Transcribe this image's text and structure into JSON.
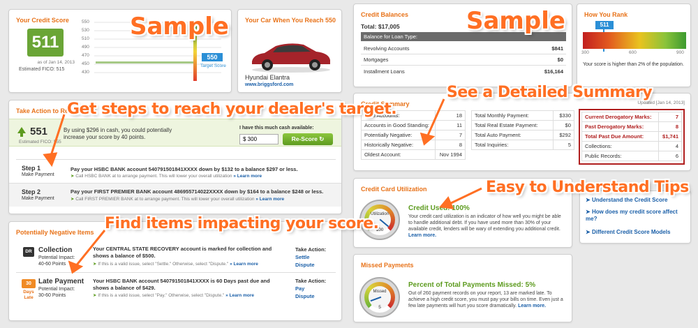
{
  "annotations": {
    "sample_left": "Sample",
    "sample_right": "Sample",
    "dealer": "Get steps to reach your dealer's target.",
    "items": "Find items impacting your score.",
    "summary": "See a Detailed Summary",
    "tips": "Easy to Understand Tips"
  },
  "credit_score": {
    "title": "Your Credit Score",
    "score": "511",
    "as_of": "as of Jan 14, 2013",
    "fico": "Estimated FICO: 515",
    "target_value": "550",
    "target_label": "Target Score",
    "ticks": [
      "550",
      "530",
      "510",
      "490",
      "470",
      "450",
      "430"
    ]
  },
  "car": {
    "title": "Your Car When You Reach 550",
    "model": "Hyundai Elantra",
    "url": "www.briggsford.com"
  },
  "balances": {
    "title": "Credit Balances",
    "total": "Total: $17,005",
    "header": "Balance for Loan Type:",
    "rows": [
      {
        "label": "Revolving Accounts",
        "value": "$841"
      },
      {
        "label": "Mortgages",
        "value": "$0"
      },
      {
        "label": "Installment Loans",
        "value": "$16,164"
      }
    ]
  },
  "rank": {
    "title": "How You Rank",
    "score": "511",
    "min": "300",
    "mid": "600",
    "max": "900",
    "text": "Your score is higher than 2% of the population."
  },
  "take_action": {
    "title": "Take Action to Re",
    "new_score": "551",
    "fico": "Estimated FICO: 555",
    "desc": "By using $296 in cash, you could potentially increase your score by 40 points.",
    "cash_label": "I have this much cash available:",
    "cash_value": "$ 300",
    "rescore": "Re-Score",
    "steps": [
      {
        "step": "Step 1",
        "sub": "Make Payment",
        "text": "Pay your HSBC BANK account 540791501841XXXX down by $132 to a balance $297 or less.",
        "hint": "Call HSBC BANK at to arrange payment. This will lower your overall utilization",
        "more": "» Learn more"
      },
      {
        "step": "Step 2",
        "sub": "Make Payment",
        "text": "Pay your FIRST PREMIER BANK account 486955714022XXXX down by $164 to a balance $248 or less.",
        "hint": "Call FIRST PREMIER BANK at to arrange payment. This will lower your overall utilization",
        "more": "» Learn more"
      }
    ]
  },
  "negative": {
    "title": "Potentially Negative Items",
    "take_action_label": "Take Action:",
    "items": [
      {
        "badge": "DR",
        "label": "Collection",
        "impact": "Potential Impact:",
        "points": "40-60 Points",
        "text": "Your CENTRAL STATE RECOVERY account is marked for collection and shows a balance of $500.",
        "hint": "If this is a valid issue, select \"Settle.\" Otherwise, select \"Dispute.\"",
        "more": "» Learn more",
        "a1": "Settle",
        "a2": "Dispute"
      },
      {
        "badge": "30",
        "badge2": "Days Late",
        "label": "Late Payment",
        "impact": "Potential Impact:",
        "points": "30-60 Points",
        "text": "Your HSBC BANK account 540791501841XXXX is 60 Days past due and shows a balance of $429.",
        "hint": "If this is a valid issue, select \"Pay.\" Otherwise, select \"Dispute.\"",
        "more": "» Learn more",
        "a1": "Pay",
        "a2": "Dispute"
      }
    ]
  },
  "summary": {
    "title": "Credit Summary",
    "updated": "Updated [Jan 14, 2013]",
    "col1": [
      {
        "label": "Total Accounts:",
        "value": "18"
      },
      {
        "label": "Accounts in Good Standing:",
        "value": "11"
      },
      {
        "label": "Potentially Negative:",
        "value": "7"
      },
      {
        "label": "Historically Negative:",
        "value": "8"
      },
      {
        "label": "Oldest Account:",
        "value": "Nov 1994"
      }
    ],
    "col2": [
      {
        "label": "Total Monthly Payment:",
        "value": "$330"
      },
      {
        "label": "Total Real Estate Payment:",
        "value": "$0"
      },
      {
        "label": "Total Auto Payment:",
        "value": "$292"
      },
      {
        "label": "Total Inquiries:",
        "value": "5"
      }
    ],
    "col3": [
      {
        "label": "Current Derogatory Marks:",
        "value": "7"
      },
      {
        "label": "Past Derogatory Marks:",
        "value": "8"
      },
      {
        "label": "Total Past Due Amount:",
        "value": "$1,741"
      },
      {
        "label": "Collections:",
        "value": "4"
      },
      {
        "label": "Public Records:",
        "value": "6"
      }
    ]
  },
  "utilization": {
    "title": "Credit Card Utilization",
    "gauge_label": "Utilization",
    "gauge_value": "100",
    "heading": "Credit Used: 100%",
    "text": "Your credit card utilization is an indicator of how well you might be able to handle additional debt. If you have used more than 30% of your available credit, lenders will be wary of extending you additional credit.",
    "more": "Learn more."
  },
  "links": [
    "Understand the Credit Score",
    "How does my credit score affect me?",
    "Different Credit Score Models"
  ],
  "missed": {
    "title": "Missed Payments",
    "gauge_label": "Missed",
    "gauge_value": "5",
    "heading": "Percent of Total Payments Missed: 5%",
    "text": "Out of 260 payment records on your report, 13 are marked late. To achieve a high credit score, you must pay your bills on time. Even just a few late payments will hurt you score dramatically.",
    "more": "Learn more."
  },
  "colors": {
    "accent": "#e8731a",
    "green": "#5d9b1f",
    "link": "#1a5fa8",
    "red": "#b01e1e"
  }
}
